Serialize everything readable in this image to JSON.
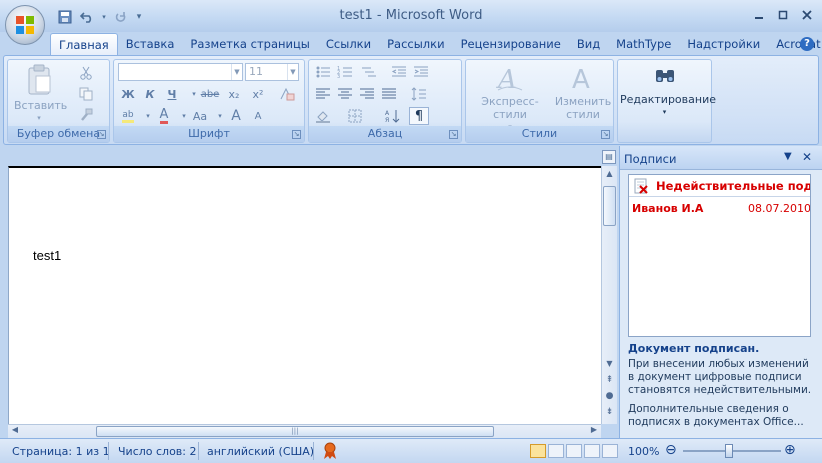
{
  "window": {
    "title": "test1 - Microsoft Word",
    "controls": [
      "minimize-icon",
      "maximize-icon",
      "close-icon"
    ]
  },
  "quick_access": {
    "icons": [
      "save-icon",
      "undo-icon",
      "redo-icon",
      "customize-icon"
    ]
  },
  "tabs": [
    "Главная",
    "Вставка",
    "Разметка страницы",
    "Ссылки",
    "Рассылки",
    "Рецензирование",
    "Вид",
    "MathType",
    "Надстройки",
    "Acrobat"
  ],
  "active_tab": "Главная",
  "ribbon": {
    "clipboard": {
      "label": "Буфер обмена",
      "paste_label": "Вставить"
    },
    "font": {
      "label": "Шрифт",
      "font_name": "",
      "font_size": "11",
      "bold": "Ж",
      "italic": "К",
      "underline": "Ч",
      "strike": "abe",
      "subscript": "x₂",
      "superscript": "x²",
      "grow": "A",
      "shrink": "A",
      "case": "Aa",
      "highlight": "ab",
      "font_color": "A"
    },
    "paragraph": {
      "label": "Абзац",
      "show_marks": "¶"
    },
    "styles": {
      "label": "Стили",
      "quick_styles": "Экспресс-стили",
      "change_styles_1": "Изменить",
      "change_styles_2": "стили"
    },
    "editing": {
      "label": "Редактирование"
    }
  },
  "document": {
    "text": "test1"
  },
  "signatures_pane": {
    "title": "Подписи",
    "invalid_header": "Недействительные подписи",
    "signer": "Иванов И.А",
    "date": "08.07.2010",
    "status": "Документ подписан.",
    "warning": "При внесении любых изменений в документ цифровые подписи становятся недействительными.",
    "more_info": "Дополнительные сведения о подписях в документах Office..."
  },
  "statusbar": {
    "page": "Страница: 1 из 1",
    "words": "Число слов: 2",
    "language": "английский (США)",
    "zoom": "100%",
    "zoom_minus": "⊖",
    "zoom_plus": "⊕"
  },
  "colors": {
    "accent": "#15428b",
    "invalid": "#d70000",
    "ribbon_bg": "#dbe8f8"
  }
}
